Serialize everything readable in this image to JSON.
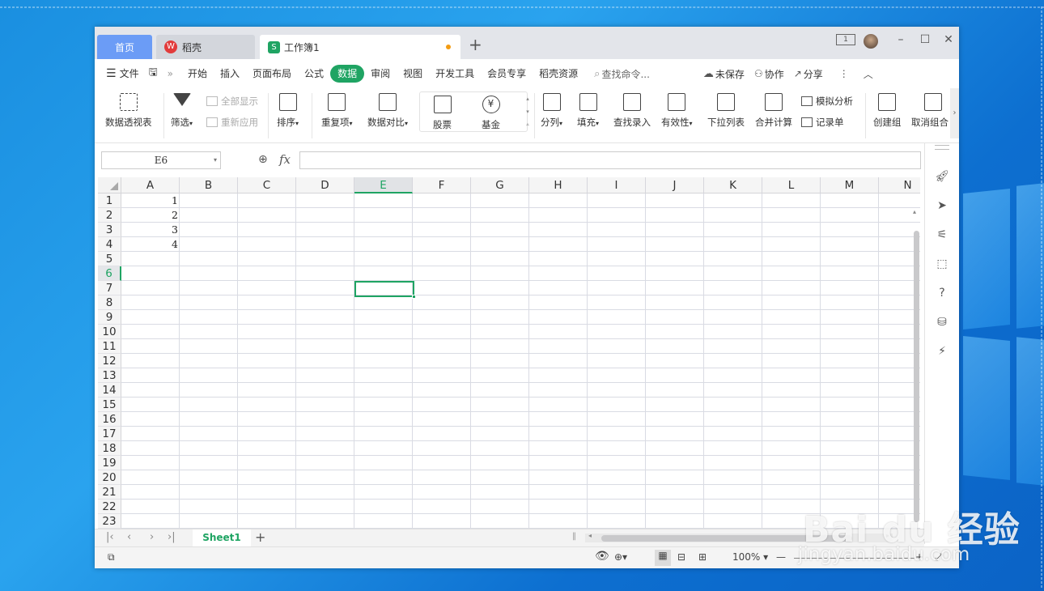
{
  "tabs": {
    "home": "首页",
    "daoke": "稻壳",
    "workbook": "工作簿1"
  },
  "menu": [
    "文件",
    "开始",
    "插入",
    "页面布局",
    "公式",
    "数据",
    "审阅",
    "视图",
    "开发工具",
    "会员专享",
    "稻壳资源"
  ],
  "active_menu": "数据",
  "search_placeholder": "查找命令...",
  "right_actions": {
    "unsaved": "未保存",
    "collab": "协作",
    "share": "分享"
  },
  "ribbon": {
    "pivot": "数据透视表",
    "filter": "筛选",
    "show_all": "全部显示",
    "reapply": "重新应用",
    "sort": "排序",
    "duplicates": "重复项",
    "compare": "数据对比",
    "stock": "股票",
    "fund": "基金",
    "split": "分列",
    "fill": "填充",
    "lookup": "查找录入",
    "validity": "有效性",
    "dropdown": "下拉列表",
    "consolidate": "合并计算",
    "whatif": "模拟分析",
    "records": "记录单",
    "group": "创建组",
    "ungroup": "取消组合"
  },
  "namebox": "E6",
  "formula_symbol": "fx",
  "columns": [
    "A",
    "B",
    "C",
    "D",
    "E",
    "F",
    "G",
    "H",
    "I",
    "J",
    "K",
    "L",
    "M",
    "N"
  ],
  "selected_column": "E",
  "rows": [
    "1",
    "2",
    "3",
    "4",
    "5",
    "6",
    "7",
    "8",
    "9",
    "10",
    "11",
    "12",
    "13",
    "14",
    "15",
    "16",
    "17",
    "18",
    "19",
    "20",
    "21",
    "22",
    "23"
  ],
  "selected_row": "6",
  "cells": {
    "A1": "1",
    "A2": "2",
    "A3": "3",
    "A4": "4"
  },
  "sheet_tab": "Sheet1",
  "zoom": "100%",
  "accent_color": "#1fa463",
  "watermark": {
    "brand": "Bai du 经验",
    "url": "jingyan.baidu.com"
  }
}
